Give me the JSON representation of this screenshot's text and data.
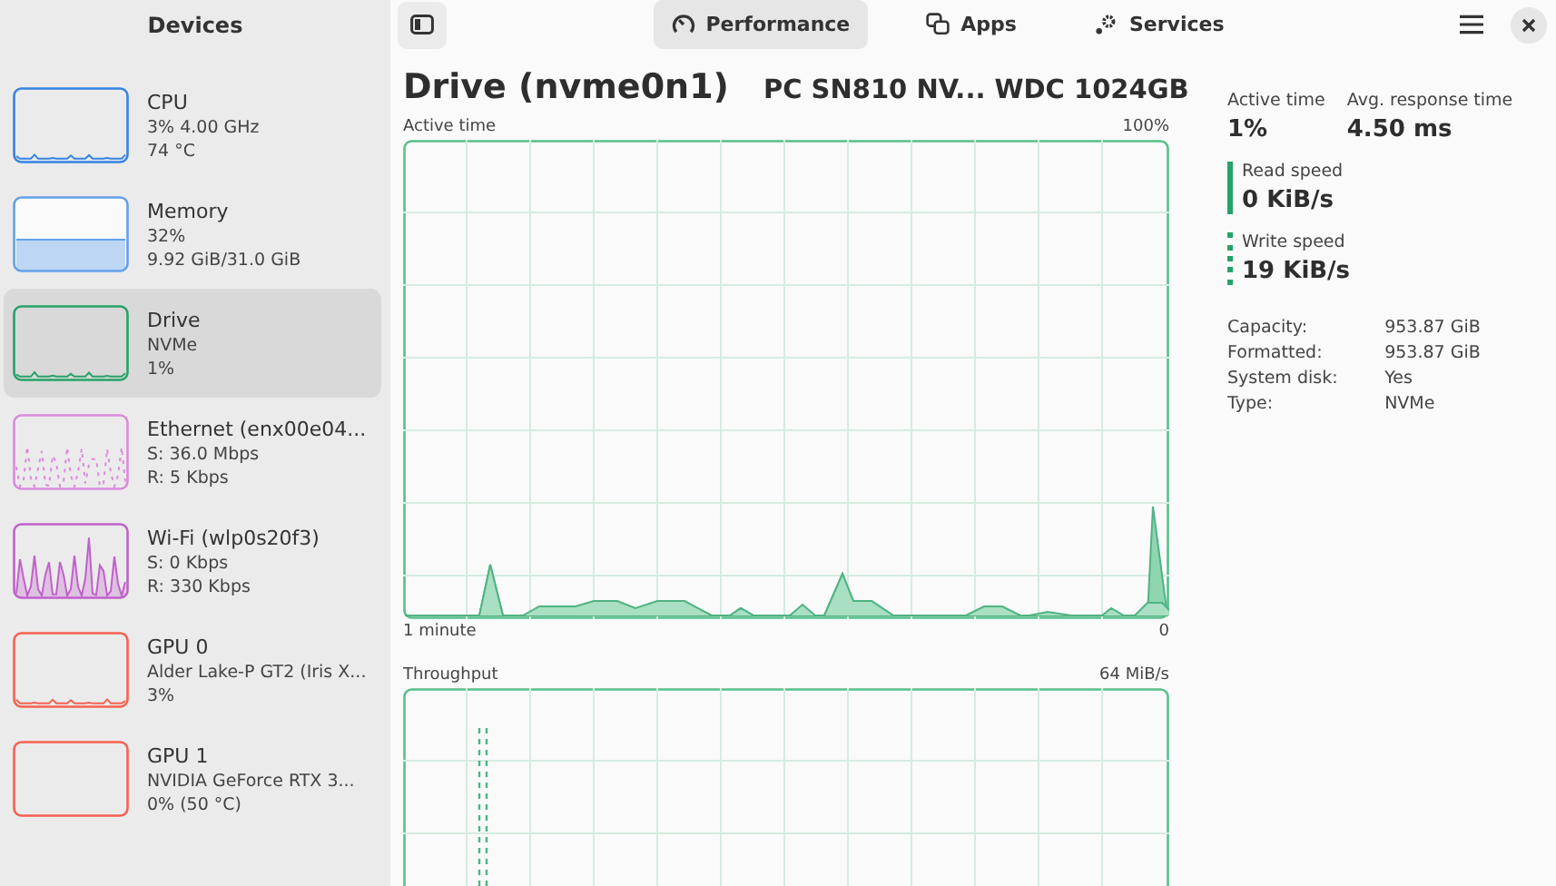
{
  "sidebar": {
    "title": "Devices",
    "devices": [
      {
        "name": "CPU",
        "lines": [
          "3% 4.00 GHz",
          "74 °C"
        ],
        "color": "#3584e4",
        "kind": "low",
        "selected": false
      },
      {
        "name": "Memory",
        "lines": [
          "32%",
          "9.92 GiB/31.0 GiB"
        ],
        "color": "#62a0ea",
        "kind": "fill",
        "selected": false
      },
      {
        "name": "Drive",
        "lines": [
          "NVMe",
          "1%"
        ],
        "color": "#26a269",
        "kind": "low",
        "selected": true
      },
      {
        "name": "Ethernet (enx00e04...",
        "lines": [
          "S: 36.0 Mbps",
          "R: 5 Kbps"
        ],
        "color": "#dc8add",
        "kind": "dotted",
        "selected": false
      },
      {
        "name": "Wi-Fi (wlp0s20f3)",
        "lines": [
          "S: 0 Kbps",
          "R: 330 Kbps"
        ],
        "color": "#c061cb",
        "kind": "spiky",
        "selected": false
      },
      {
        "name": "GPU 0",
        "lines": [
          "Alder Lake-P GT2 (Iris X...",
          "3%"
        ],
        "color": "#f66151",
        "kind": "low",
        "selected": false
      },
      {
        "name": "GPU 1",
        "lines": [
          "NVIDIA GeForce RTX 3...",
          "0% (50 °C)"
        ],
        "color": "#f66151",
        "kind": "empty",
        "selected": false
      }
    ]
  },
  "header": {
    "tabs": [
      {
        "label": "Performance",
        "selected": true
      },
      {
        "label": "Apps",
        "selected": false
      },
      {
        "label": "Services",
        "selected": false
      }
    ]
  },
  "title": "Drive (nvme0n1)",
  "subtitle": "PC SN810 NV... WDC 1024GB",
  "graphs": [
    {
      "label": "Active time",
      "max": "100%",
      "left_foot": "1 minute",
      "right_foot": "0",
      "kind": "area"
    },
    {
      "label": "Throughput",
      "max": "64 MiB/s",
      "kind": "dashed"
    }
  ],
  "stats": {
    "top": [
      {
        "label": "Active time",
        "value": "1%"
      },
      {
        "label": "Avg. response time",
        "value": "4.50 ms"
      }
    ],
    "speeds": [
      {
        "label": "Read speed",
        "value": "0 KiB/s",
        "kind": "solid"
      },
      {
        "label": "Write speed",
        "value": "19 KiB/s",
        "kind": "dotted"
      }
    ],
    "details": [
      {
        "key": "Capacity:",
        "value": "953.87 GiB"
      },
      {
        "key": "Formatted:",
        "value": "953.87 GiB"
      },
      {
        "key": "System disk:",
        "value": "Yes"
      },
      {
        "key": "Type:",
        "value": "NVMe"
      }
    ]
  }
}
